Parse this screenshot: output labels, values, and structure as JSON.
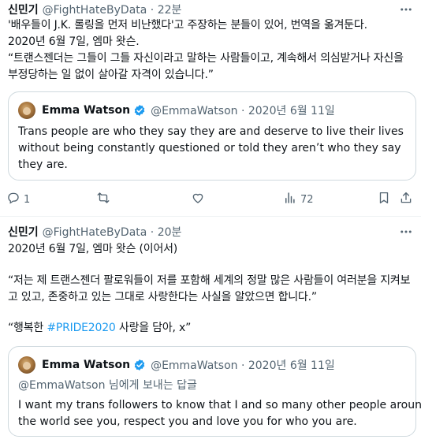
{
  "tweet1": {
    "author_name": "신민기",
    "meta": "@FightHateByData · 22분",
    "lines": [
      "'배우들이 J.K. 롤링을 먼저 비난했다'고 주장하는 분들이 있어, 번역을 옮겨둔다.",
      "2020년 6월 7일, 엠마 왓슨.",
      "“트랜스젠더는 그들이 그들 자신이라고 말하는 사람들이고, 계속해서 의심받거나 자신을",
      "부정당하는 일 없이 살아갈 자격이 있습니다.”"
    ],
    "quote": {
      "name": "Emma Watson",
      "meta": "@EmmaWatson · 2020년 6월 11일",
      "lines": [
        "Trans people are who they say they are and deserve to live their lives",
        "without being constantly questioned or told they aren’t who they say",
        "they are."
      ]
    },
    "actions": {
      "reply_count": "1",
      "retweet_count": "",
      "like_count": "",
      "views_count": "72"
    }
  },
  "tweet2": {
    "author_name": "신민기",
    "meta": "@FightHateByData · 20분",
    "lines": [
      "2020년 6월 7일, 엠마 왓슨 (이어서)",
      "“저는 제 트랜스젠더 팔로워들이 저를 포함해 세계의 정말 많은 사람들이 여러분을 지켜보",
      "고 있고, 존중하고 있는 그대로 사랑한다는 사실을 알았으면 합니다.”"
    ],
    "closing_prefix": "“행복한 ",
    "hashtag": "#PRIDE2020",
    "closing_suffix": " 사랑을 담아, x”",
    "quote": {
      "name": "Emma Watson",
      "meta": "@EmmaWatson · 2020년 6월 11일",
      "reply_to": "@EmmaWatson 님에게 보내는 답글",
      "lines": [
        "I want my trans followers to know that I and so many other people around",
        "the world see you, respect you and love you for who you are."
      ]
    }
  },
  "colors": {
    "text": "#0f1419",
    "secondary": "#536471",
    "accent": "#1d9bf0",
    "border": "#cfd9de",
    "verified": "#1d9bf0"
  }
}
